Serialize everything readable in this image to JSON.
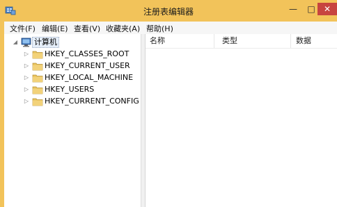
{
  "window": {
    "title": "注册表编辑器",
    "minimize": "—",
    "maximize": "□",
    "close": "✕"
  },
  "menu": {
    "items": [
      {
        "label": "文件(F)"
      },
      {
        "label": "编辑(E)"
      },
      {
        "label": "查看(V)"
      },
      {
        "label": "收藏夹(A)"
      },
      {
        "label": "帮助(H)"
      }
    ]
  },
  "tree": {
    "root": {
      "label": "计算机",
      "expanded": true
    },
    "children": [
      {
        "label": "HKEY_CLASSES_ROOT"
      },
      {
        "label": "HKEY_CURRENT_USER"
      },
      {
        "label": "HKEY_LOCAL_MACHINE"
      },
      {
        "label": "HKEY_USERS"
      },
      {
        "label": "HKEY_CURRENT_CONFIG"
      }
    ]
  },
  "list": {
    "columns": [
      {
        "label": "名称"
      },
      {
        "label": "类型"
      },
      {
        "label": "数据"
      }
    ]
  },
  "colors": {
    "frame": "#f2c35a",
    "close_button": "#c7443f",
    "folder": "#e8c35c"
  }
}
